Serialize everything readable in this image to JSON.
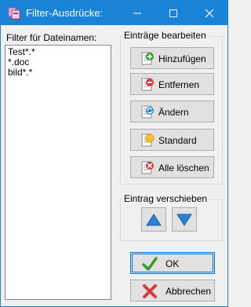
{
  "window": {
    "title": "Filter-Ausdrücke:"
  },
  "filter": {
    "label": "Filter für Dateinamen:",
    "items": [
      "Test*.*",
      "*.doc",
      "bild*.*"
    ]
  },
  "edit_group": {
    "title": "Einträge bearbeiten",
    "add_label": "Hinzufügen",
    "remove_label": "Entfernen",
    "change_label": "Ändern",
    "default_label": "Standard",
    "clear_all_label": "Alle löschen"
  },
  "move_group": {
    "title": "Eintrag verschieben"
  },
  "dialog": {
    "ok_label": "OK",
    "cancel_label": "Abbrechen"
  },
  "colors": {
    "titlebar": "#1883d7",
    "arrow": "#2b7fd4",
    "ok_check": "#2e9e2e",
    "cancel_x": "#d83b3b"
  }
}
